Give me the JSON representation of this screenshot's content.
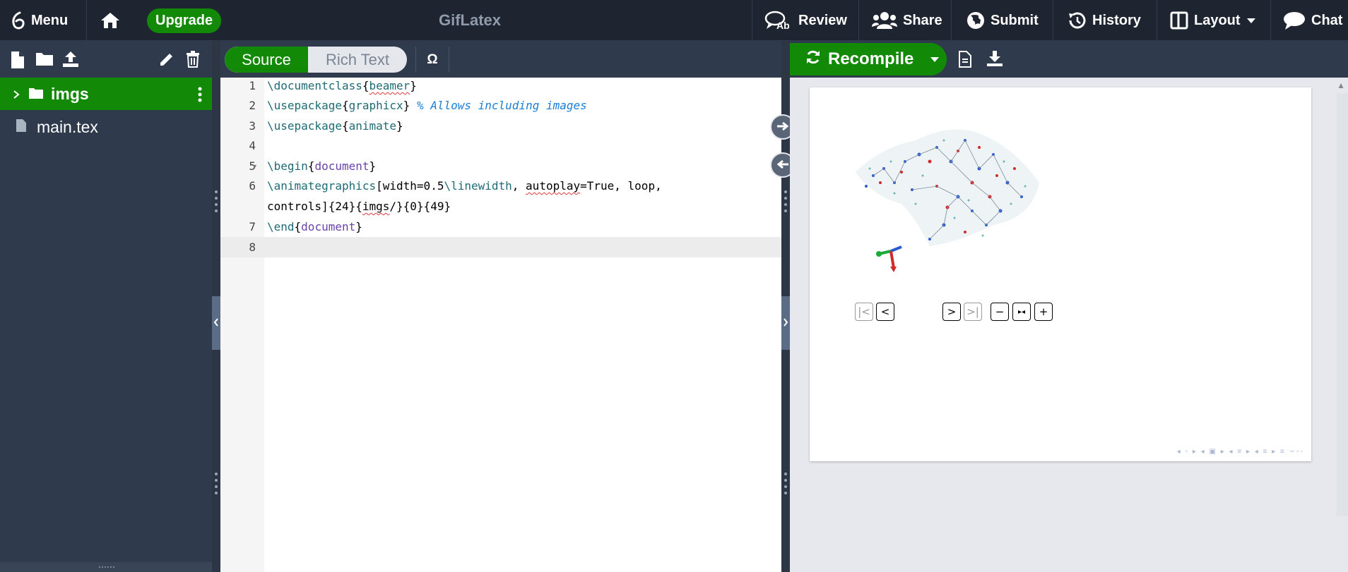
{
  "topbar": {
    "menu_label": "Menu",
    "upgrade_label": "Upgrade",
    "project_title": "GifLatex",
    "review_label": "Review",
    "share_label": "Share",
    "submit_label": "Submit",
    "history_label": "History",
    "layout_label": "Layout",
    "chat_label": "Chat"
  },
  "file_tree": {
    "folder_name": "imgs",
    "file_name": "main.tex"
  },
  "editor": {
    "source_label": "Source",
    "rich_text_label": "Rich Text",
    "symbol_label": "Ω",
    "line_numbers": [
      "1",
      "2",
      "3",
      "4",
      "5",
      "6",
      "7",
      "8"
    ],
    "lines": {
      "l1_cmd": "\\documentclass",
      "l1_arg": "beamer",
      "l2_cmd": "\\usepackage",
      "l2_arg": "graphicx",
      "l2_comment": "% Allows including images",
      "l3_cmd": "\\usepackage",
      "l3_arg": "animate",
      "l5_cmd": "\\begin",
      "l5_arg": "document",
      "l6_cmd": "\\animategraphics",
      "l6_opt1": "[width=0.5",
      "l6_cmd2": "\\linewidth",
      "l6_opt2a": ", ",
      "l6_opt2b": "autoplay",
      "l6_opt2c": "=True, loop,",
      "l6_cont_a": "controls]{24}{",
      "l6_cont_b": "imgs",
      "l6_cont_c": "/}{0}{49}",
      "l7_cmd": "\\end",
      "l7_arg": "document"
    }
  },
  "pdf": {
    "recompile_label": "Recompile",
    "controls": [
      "|<",
      "<",
      ">",
      ">|",
      "−",
      "▸◂",
      "+"
    ]
  },
  "colors": {
    "accent_green": "#138a07",
    "topbar_bg": "#1e2530",
    "panel_bg": "#2f3a4c"
  }
}
